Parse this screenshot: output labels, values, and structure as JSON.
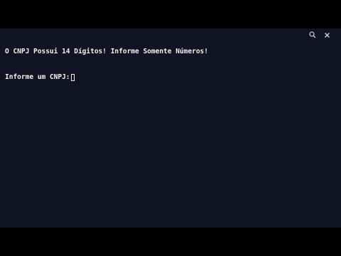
{
  "terminal": {
    "lines": [
      "O CNPJ Possui 14 Dígitos! Informe Somente Números!",
      "Informe um CNPJ:"
    ]
  },
  "toolbar": {
    "search_icon": "search-icon",
    "close_icon": "close-icon"
  },
  "colors": {
    "terminal_bg": "#0f1322",
    "text": "#f2f2f2",
    "letterbox": "#000000"
  }
}
